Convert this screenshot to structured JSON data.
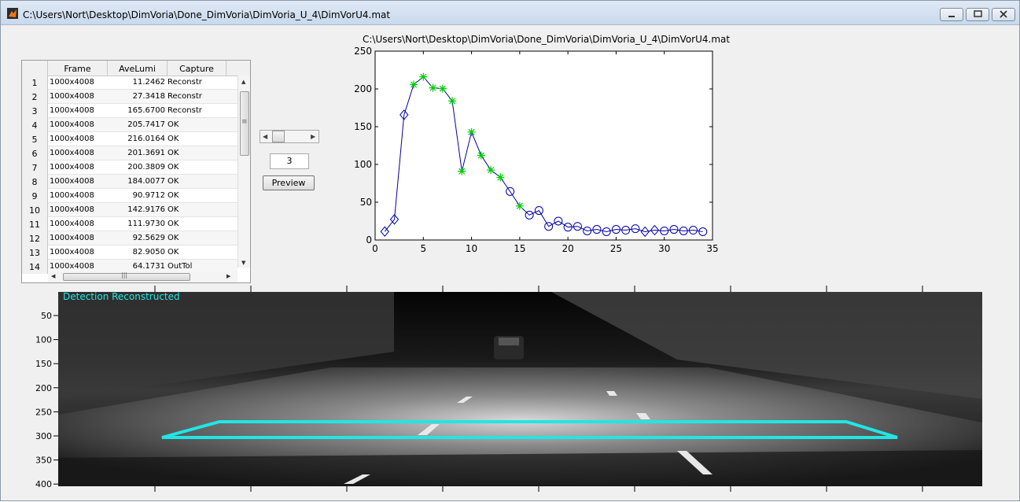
{
  "window": {
    "title": "C:\\Users\\Nort\\Desktop\\DimVoria\\Done_DimVoria\\DimVoria_U_4\\DimVorU4.mat"
  },
  "table": {
    "headers": [
      "Frame",
      "AveLumi",
      "Capture"
    ],
    "rows": [
      {
        "n": "1",
        "frame": "1000x4008",
        "lumi": "11.2462",
        "cap": "Reconstr"
      },
      {
        "n": "2",
        "frame": "1000x4008",
        "lumi": "27.3418",
        "cap": "Reconstr"
      },
      {
        "n": "3",
        "frame": "1000x4008",
        "lumi": "165.6700",
        "cap": "Reconstr"
      },
      {
        "n": "4",
        "frame": "1000x4008",
        "lumi": "205.7417",
        "cap": "OK"
      },
      {
        "n": "5",
        "frame": "1000x4008",
        "lumi": "216.0164",
        "cap": "OK"
      },
      {
        "n": "6",
        "frame": "1000x4008",
        "lumi": "201.3691",
        "cap": "OK"
      },
      {
        "n": "7",
        "frame": "1000x4008",
        "lumi": "200.3809",
        "cap": "OK"
      },
      {
        "n": "8",
        "frame": "1000x4008",
        "lumi": "184.0077",
        "cap": "OK"
      },
      {
        "n": "9",
        "frame": "1000x4008",
        "lumi": "90.9712",
        "cap": "OK"
      },
      {
        "n": "10",
        "frame": "1000x4008",
        "lumi": "142.9176",
        "cap": "OK"
      },
      {
        "n": "11",
        "frame": "1000x4008",
        "lumi": "111.9730",
        "cap": "OK"
      },
      {
        "n": "12",
        "frame": "1000x4008",
        "lumi": "92.5629",
        "cap": "OK"
      },
      {
        "n": "13",
        "frame": "1000x4008",
        "lumi": "82.9050",
        "cap": "OK"
      },
      {
        "n": "14",
        "frame": "1000x4008",
        "lumi": "64.1731",
        "cap": "OutTol"
      }
    ]
  },
  "controls": {
    "frame_value": "3",
    "preview_label": "Preview",
    "hscroll_grip": "|||",
    "vscroll_grip": "≡"
  },
  "chart_data": {
    "type": "line",
    "title": "C:\\Users\\Nort\\Desktop\\DimVoria\\Done_DimVoria\\DimVoria_U_4\\DimVorU4.mat",
    "xlim": [
      0,
      35
    ],
    "ylim": [
      0,
      250
    ],
    "xticks": [
      0,
      5,
      10,
      15,
      20,
      25,
      30,
      35
    ],
    "yticks": [
      0,
      50,
      100,
      150,
      200,
      250
    ],
    "grid": false,
    "line_color": "#0000aa",
    "marker_colors": {
      "diamond": "#0000aa",
      "star": "#00cc00",
      "circle": "#0000aa"
    },
    "series": [
      {
        "x": [
          1,
          2,
          3,
          4,
          5,
          6,
          7,
          8,
          9,
          10,
          11,
          12,
          13,
          14,
          15,
          16,
          17,
          18,
          19,
          20,
          21,
          22,
          23,
          24,
          25,
          26,
          27,
          28,
          29,
          30,
          31,
          32,
          33,
          34
        ],
        "values": [
          11.2,
          27.3,
          165.7,
          205.7,
          216.0,
          201.4,
          200.4,
          184.0,
          91.0,
          142.9,
          112.0,
          92.6,
          82.9,
          64.2,
          45,
          33,
          39,
          18,
          25,
          17,
          18,
          12,
          14,
          11,
          14,
          13,
          15,
          11,
          13,
          12,
          14,
          12,
          13,
          11
        ],
        "markers": [
          "diamond",
          "diamond",
          "diamond",
          "star",
          "star",
          "star",
          "star",
          "star",
          "star",
          "star",
          "star",
          "star",
          "star",
          "circle",
          "star",
          "circle",
          "circle",
          "circle",
          "circle",
          "circle",
          "circle",
          "circle",
          "circle",
          "circle",
          "circle",
          "circle",
          "circle",
          "diamond",
          "diamond",
          "circle",
          "circle",
          "circle",
          "circle",
          "circle"
        ]
      }
    ]
  },
  "image_panel": {
    "label": "Detection Reconstructed",
    "yticks": [
      "50",
      "100",
      "150",
      "200",
      "250",
      "300",
      "350",
      "400"
    ],
    "overlay_color": "#22e5e5",
    "background": "grayscale tunnel road scene"
  }
}
